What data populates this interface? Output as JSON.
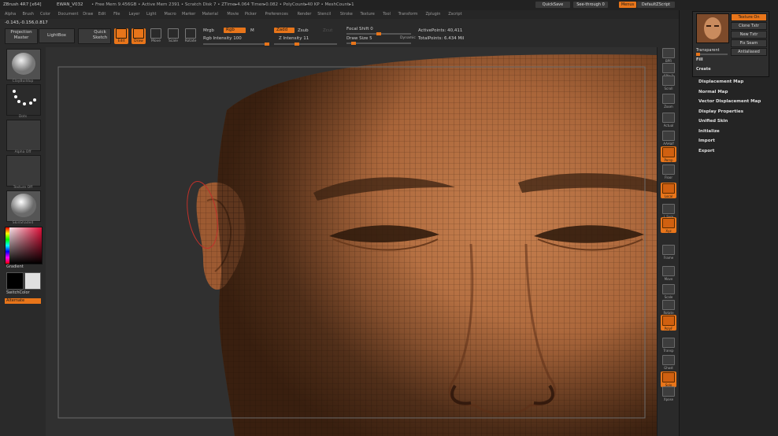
{
  "titlebar": {
    "app": "ZBrush 4R7 [x64]",
    "doc": "EWAN_V032",
    "stats": "• Free Mem 9.456GB • Active Mem 2391 • Scratch Disk 7 • ZTime▸4.064 Timer▸0.082 • PolyCount▸40 KP • MeshCount▸1"
  },
  "topright": {
    "quicksave": "QuickSave",
    "seethrough": "See-through",
    "seethrough_value": "0",
    "menus": "Menus",
    "default_zscript": "DefaultZScript"
  },
  "menus": [
    "Alpha",
    "Brush",
    "Color",
    "Document",
    "Draw",
    "Edit",
    "File",
    "Layer",
    "Light",
    "Macro",
    "Marker",
    "Material",
    "Movie",
    "Picker",
    "Preferences",
    "Render",
    "Stencil",
    "Stroke",
    "Texture",
    "Tool",
    "Transform",
    "Zplugin",
    "Zscript"
  ],
  "shelf": {
    "coords": "-0.143,-0.156,0.817",
    "projection_master": "Projection Master",
    "lightbox": "LightBox",
    "quick_sketch": "Quick Sketch",
    "tools": [
      {
        "id": "edit",
        "label": "Edit",
        "on": true
      },
      {
        "id": "draw",
        "label": "Draw",
        "on": true
      },
      {
        "id": "move",
        "label": "Move",
        "on": false
      },
      {
        "id": "scale",
        "label": "Scale",
        "on": false
      },
      {
        "id": "rotate",
        "label": "Rotate",
        "on": false
      }
    ],
    "mrgb": "Mrgb",
    "rgb": "Rgb",
    "m": "M",
    "rgb_intensity": "Rgb Intensity 100",
    "zadd": "Zadd",
    "zsub": "Zsub",
    "zcut": "Zcut",
    "z_intensity": "Z Intensity 11",
    "focal_shift": "Focal Shift 0",
    "draw_size": "Draw Size 5",
    "dynamic": "Dynamic",
    "active_points": "ActivePoints: 40,411",
    "total_points": "TotalPoints: 6.434 Mil"
  },
  "lefttray": {
    "brush_label": "ClayBuildup",
    "stroke_label": "Dots",
    "alpha_label": "Alpha Off",
    "texture_label": "Texture Off",
    "material_label": "SkinShade4",
    "gradient": "Gradient",
    "switch_color": "SwitchColor",
    "alternate": "Alternate"
  },
  "righttray": [
    {
      "id": "bpr",
      "label": "BPR",
      "on": false
    },
    {
      "id": "spix",
      "label": "SPix 3",
      "on": false
    },
    {
      "id": "scroll",
      "label": "Scroll",
      "on": false
    },
    {
      "id": "zoom",
      "label": "Zoom",
      "on": false
    },
    {
      "id": "actual",
      "label": "Actual",
      "on": false
    },
    {
      "id": "aahalf",
      "label": "AAHalf",
      "on": false
    },
    {
      "id": "persp",
      "label": "Persp",
      "on": true
    },
    {
      "id": "floor",
      "label": "Floor",
      "on": false
    },
    {
      "id": "local",
      "label": "Local",
      "on": true
    },
    {
      "id": "lsym",
      "label": "L.Sym",
      "on": false
    },
    {
      "id": "xyz",
      "label": "Xyz",
      "on": true
    },
    {
      "id": "frame",
      "label": "Frame",
      "on": false
    },
    {
      "id": "move",
      "label": "Move",
      "on": false
    },
    {
      "id": "scale",
      "label": "Scale",
      "on": false
    },
    {
      "id": "rotate",
      "label": "Rotate",
      "on": false
    },
    {
      "id": "polyf",
      "label": "PolyF",
      "on": true
    },
    {
      "id": "transp",
      "label": "Transp",
      "on": false
    },
    {
      "id": "ghost",
      "label": "Ghost",
      "on": false
    },
    {
      "id": "solo",
      "label": "Solo",
      "on": true
    },
    {
      "id": "xpose",
      "label": "Xpose",
      "on": false
    }
  ],
  "texture_popup": {
    "texture_on": "Texture On",
    "clone_txtr": "Clone Txtr",
    "new_txtr": "New Txtr",
    "fix_seam": "Fix Seam",
    "antialiased": "Antialiased",
    "transparent": "Transparent",
    "fill": "Fill",
    "create": "Create"
  },
  "palette_items": [
    "Displacement Map",
    "Normal Map",
    "Vector Displacement Map",
    "Display Properties",
    "Unified Skin",
    "Initialize",
    "Import",
    "Export"
  ],
  "colors": {
    "accent": "#e8751a",
    "bg": "#2a2a2a",
    "skin": "#b06a3e"
  }
}
